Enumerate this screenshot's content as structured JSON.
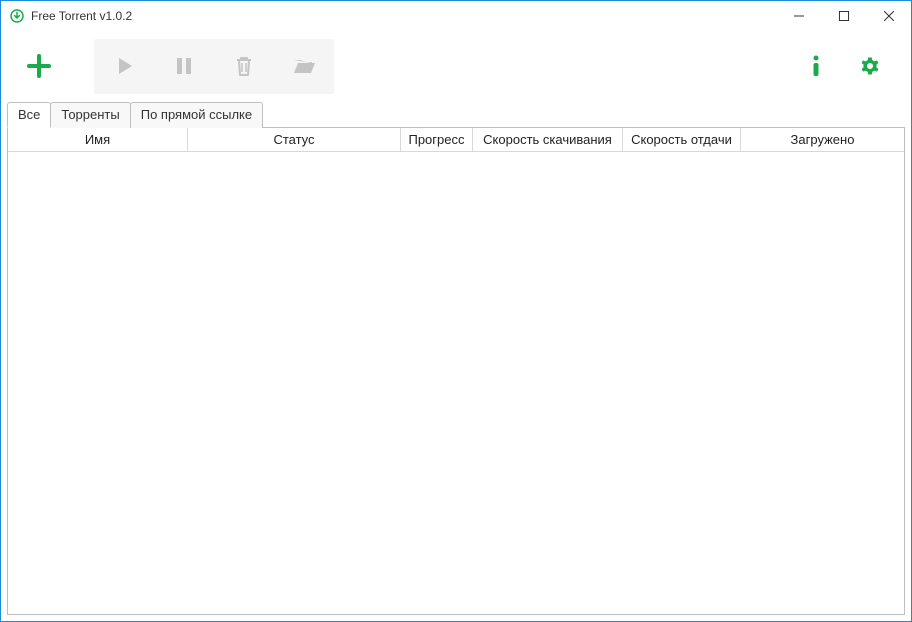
{
  "titlebar": {
    "title": "Free Torrent v1.0.2"
  },
  "colors": {
    "accent": "#1aab4a",
    "disabled": "#c4c4c4"
  },
  "tabs": [
    {
      "label": "Все",
      "active": true
    },
    {
      "label": "Торренты",
      "active": false
    },
    {
      "label": "По прямой ссылке",
      "active": false
    }
  ],
  "columns": {
    "name": "Имя",
    "status": "Статус",
    "progress": "Прогресс",
    "dlspeed": "Скорость скачивания",
    "upspeed": "Скорость отдачи",
    "loaded": "Загружено"
  },
  "rows": []
}
